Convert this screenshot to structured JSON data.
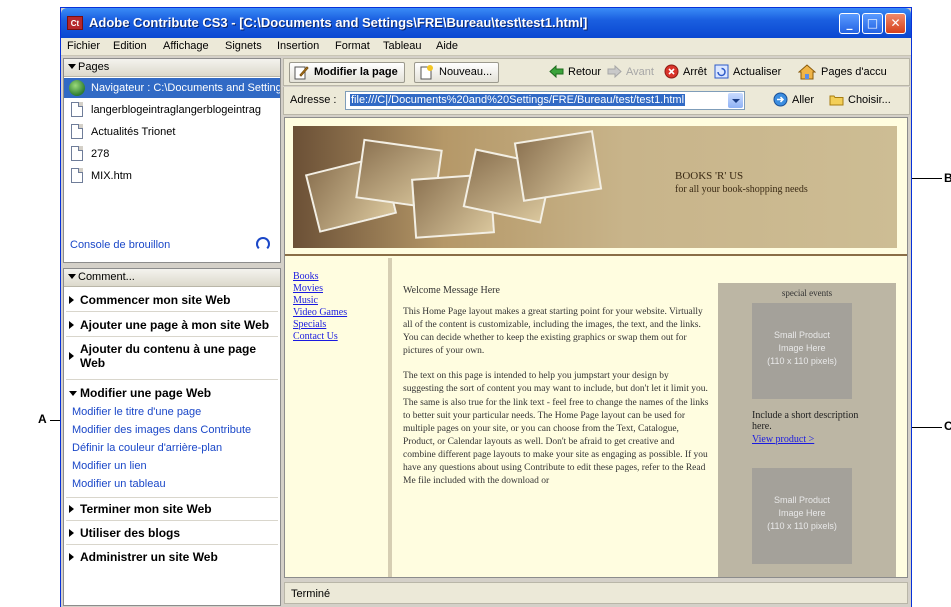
{
  "window": {
    "title": "Adobe Contribute CS3 - [C:\\Documents and Settings\\FRE\\Bureau\\test\\test1.html]",
    "app_icon": "Ct"
  },
  "menubar": [
    "Fichier",
    "Edition",
    "Affichage",
    "Signets",
    "Insertion",
    "Format",
    "Tableau",
    "Aide"
  ],
  "pages_panel": {
    "header": "Pages",
    "items": [
      {
        "label": "Navigateur : C:\\Documents and Settings",
        "icon": "navigator-icon",
        "selected": true
      },
      {
        "label": "langerblogeintraglangerblogeintrag",
        "icon": "document-icon",
        "selected": false
      },
      {
        "label": "Actualités Trionet",
        "icon": "document-icon",
        "selected": false
      },
      {
        "label": "278",
        "icon": "document-icon",
        "selected": false
      },
      {
        "label": "MIX.htm",
        "icon": "document-icon",
        "selected": false
      }
    ],
    "console_link": "Console de brouillon"
  },
  "how_to_panel": {
    "header": "Comment...",
    "sections": [
      {
        "label": "Commencer mon site Web",
        "expanded": false
      },
      {
        "label": "Ajouter une page à mon site Web",
        "expanded": false
      },
      {
        "label": "Ajouter du contenu à une page Web",
        "expanded": false
      },
      {
        "label": "Modifier une page Web",
        "expanded": true
      },
      {
        "label": "Terminer mon site Web",
        "expanded": false
      },
      {
        "label": "Utiliser des blogs",
        "expanded": false
      },
      {
        "label": "Administrer un site Web",
        "expanded": false
      }
    ],
    "links": [
      "Modifier le titre d'une page",
      "Modifier des images dans Contribute",
      "Définir la couleur d'arrière-plan",
      "Modifier un lien",
      "Modifier un tableau"
    ]
  },
  "toolbar": {
    "edit_page": "Modifier la page",
    "new": "Nouveau...",
    "back": "Retour",
    "forward": "Avant",
    "stop": "Arrêt",
    "refresh": "Actualiser",
    "home": "Pages d'accu"
  },
  "address_bar": {
    "label": "Adresse :",
    "value": "file:///C|/Documents%20and%20Settings/FRE/Bureau/test/test1.html",
    "go": "Aller",
    "choose": "Choisir..."
  },
  "webpage": {
    "banner_title": "BOOKS 'R' US",
    "banner_tagline": "for all your book-shopping needs",
    "nav_links": [
      "Books",
      "Movies",
      "Music",
      "Video Games",
      "Specials",
      "Contact Us"
    ],
    "welcome": "Welcome Message Here",
    "paragraph1": "This Home Page layout makes a great starting point for your website. Virtually all of the content is customizable, including the images, the text, and the links. You can decide whether to keep the existing graphics or swap them out for pictures of your own.",
    "paragraph2": "The text on this page is intended to help you jumpstart your design by suggesting the sort of content you may want to include, but don't let it limit you. The same is also true for the link text - feel free to change the names of the links to better suit your particular needs. The Home Page layout can be used for multiple pages on your site, or you can choose from the Text, Catalogue, Product, or Calendar layouts as well. Don't be afraid to get creative and combine different page layouts to make your site as engaging as possible. If you have any questions about using Contribute to edit these pages, refer to the Read Me file included with the download or",
    "special_title": "special events",
    "product_box": [
      "Small Product",
      "Image Here",
      "(110 x 110 pixels)"
    ],
    "product_desc": "Include a short description here.",
    "view_link": "View product >"
  },
  "status_bar": "Terminé",
  "callouts": [
    "A",
    "B",
    "C"
  ]
}
